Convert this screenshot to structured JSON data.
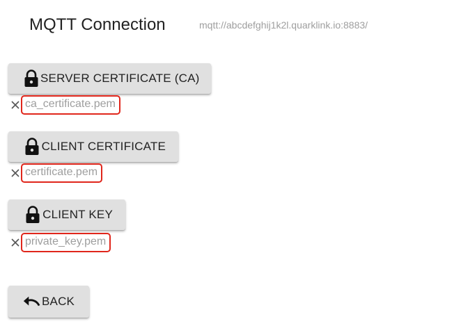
{
  "header": {
    "title": "MQTT Connection",
    "url": "mqtt://abcdefghij1k2l.quarklink.io:8883/"
  },
  "certificates": {
    "ca": {
      "button_label": "SERVER CERTIFICATE (CA)",
      "icon": "lock-icon",
      "file_name": "ca_certificate.pem"
    },
    "client_cert": {
      "button_label": "CLIENT CERTIFICATE",
      "icon": "lock-icon",
      "file_name": "certificate.pem"
    },
    "client_key": {
      "button_label": "CLIENT KEY",
      "icon": "lock-icon",
      "file_name": "private_key.pem"
    }
  },
  "footer": {
    "back_label": "BACK",
    "back_icon": "undo-icon"
  },
  "colors": {
    "button_bg": "#e0e0e0",
    "highlight_border": "#e0261b",
    "muted_text": "#9e9e9e"
  }
}
